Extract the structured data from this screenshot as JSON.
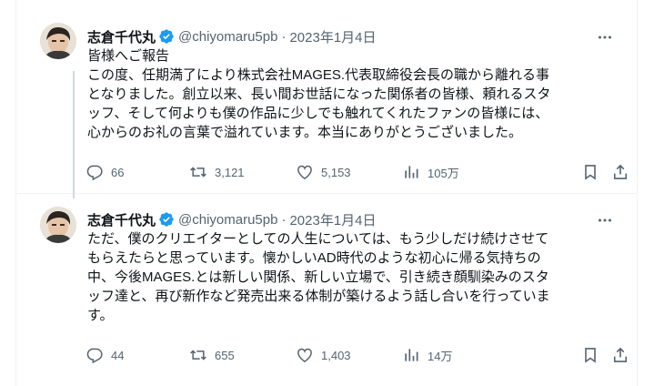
{
  "tweets": [
    {
      "author": {
        "name": "志倉千代丸",
        "handle": "@chiyomaru5pb",
        "verified": true
      },
      "separator": "·",
      "date": "2023年1月4日",
      "lines": [
        "皆様へご報告",
        "この度、任期満了により株式会社MAGES.代表取締役会長の職から離れる事",
        "となりました。創立以来、長い間お世話になった関係者の皆様、頼れるスタ",
        "ッフ、そして何よりも僕の作品に少しでも触れてくれたファンの皆様には、",
        "心からのお礼の言葉で溢れています。本当にありがとうございました。"
      ],
      "stats": {
        "replies": "66",
        "retweets": "3,121",
        "likes": "5,153",
        "views": "105万"
      }
    },
    {
      "author": {
        "name": "志倉千代丸",
        "handle": "@chiyomaru5pb",
        "verified": true
      },
      "separator": "·",
      "date": "2023年1月4日",
      "lines": [
        "ただ、僕のクリエイターとしての人生については、もう少しだけ続けさせて",
        "もらえたらと思っています。懐かしいAD時代のような初心に帰る気持ちの",
        "中、今後MAGES.とは新しい関係、新しい立場で、引き続き顔馴染みのスタ",
        "ッフ達と、再び新作など発売出来る体制が築けるよう話し合いを行っていま",
        "す。"
      ],
      "stats": {
        "replies": "44",
        "retweets": "655",
        "likes": "1,403",
        "views": "14万"
      }
    }
  ],
  "icons": {
    "more": "more-horizontal-icon",
    "verified": "verified-badge-icon",
    "reply": "reply-icon",
    "retweet": "retweet-icon",
    "like": "heart-icon",
    "views": "views-chart-icon",
    "bookmark": "bookmark-icon",
    "share": "share-icon"
  },
  "colors": {
    "verified": "#1d9bf0",
    "text": "#0f1419",
    "secondary": "#536471",
    "thread_line": "#cfd9de",
    "divider": "#eff3f4"
  }
}
